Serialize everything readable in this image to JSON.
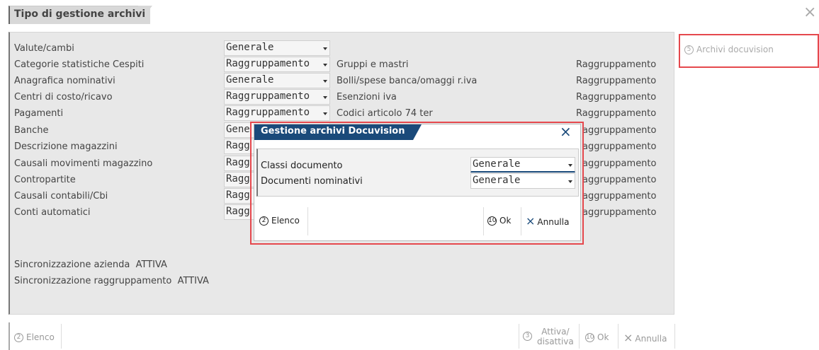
{
  "window": {
    "title": "Tipo di gestione archivi"
  },
  "rows": [
    {
      "label": "Valute/cambi",
      "value": "Generale"
    },
    {
      "label": "Categorie statistiche Cespiti",
      "value": "Raggruppamento"
    },
    {
      "label": "Anagrafica nominativi",
      "value": "Generale"
    },
    {
      "label": "Centri di costo/ricavo",
      "value": "Raggruppamento"
    },
    {
      "label": "Pagamenti",
      "value": "Raggruppamento"
    },
    {
      "label": "Banche",
      "value": "Gene"
    },
    {
      "label": "Descrizione magazzini",
      "value": "Ragg"
    },
    {
      "label": "Causali movimenti magazzino",
      "value": "Ragg"
    },
    {
      "label": "Contropartite",
      "value": "Ragg"
    },
    {
      "label": "Causali contabili/Cbi",
      "value": "Ragg"
    },
    {
      "label": "Conti automatici",
      "value": "Ragg"
    }
  ],
  "col2": [
    {
      "label": "Gruppi e mastri",
      "value": "Raggruppamento"
    },
    {
      "label": "Bolli/spese banca/omaggi r.iva",
      "value": "Raggruppamento"
    },
    {
      "label": "Esenzioni iva",
      "value": "Raggruppamento"
    },
    {
      "label": "Codici articolo 74 ter",
      "value": "Raggruppamento"
    },
    {
      "label": "",
      "value": "aggruppamento"
    },
    {
      "label": "",
      "value": "aggruppamento"
    },
    {
      "label": "",
      "value": "aggruppamento"
    },
    {
      "label": "",
      "value": "aggruppamento"
    },
    {
      "label": "",
      "value": "aggruppamento"
    },
    {
      "label": "",
      "value": "aggruppamento"
    }
  ],
  "sync": {
    "azienda_label": "Sincronizzazione azienda",
    "azienda_value": "ATTIVA",
    "raggr_label": "Sincronizzazione raggruppamento",
    "raggr_value": "ATTIVA"
  },
  "side": {
    "archivi_key": "5",
    "archivi_label": "Archivi docuvision"
  },
  "bottom": {
    "elenco_key": "2",
    "elenco_label": "Elenco",
    "attiva_key": "3",
    "attiva_label_1": "Attiva/",
    "attiva_label_2": "disattiva",
    "ok_key": "10",
    "ok_label": "Ok",
    "annulla_label": "Annulla"
  },
  "dialog": {
    "title": "Gestione archivi Docuvision",
    "fields": [
      {
        "label": "Classi documento",
        "value": "Generale"
      },
      {
        "label": "Documenti nominativi",
        "value": "Generale"
      }
    ],
    "elenco_key": "2",
    "elenco_label": "Elenco",
    "ok_key": "10",
    "ok_label": "Ok",
    "annulla_label": "Annulla"
  },
  "colors": {
    "accent": "#1a4a7a",
    "highlight": "#e5484d"
  }
}
